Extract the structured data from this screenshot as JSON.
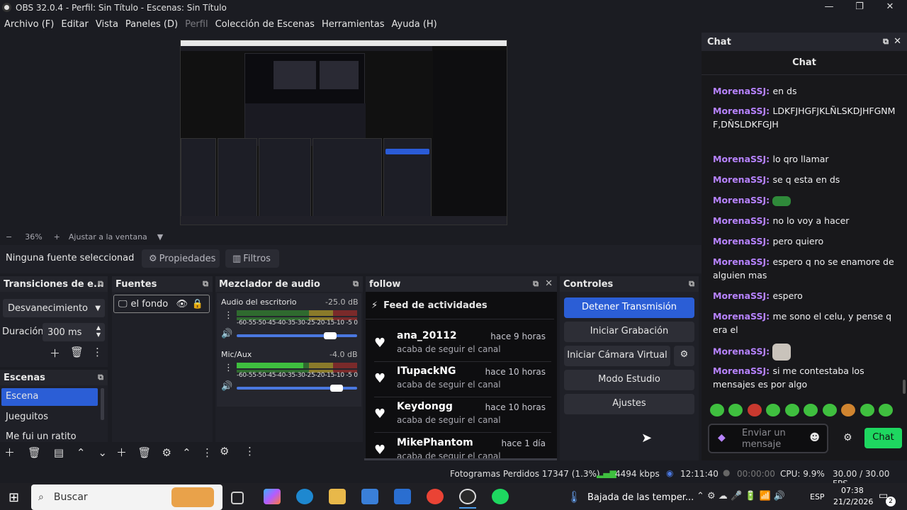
{
  "window": {
    "title": "OBS 32.0.4 - Perfil: Sin Título - Escenas: Sin Título"
  },
  "menu": [
    "Archivo (F)",
    "Editar",
    "Vista",
    "Paneles (D)",
    "Perfil",
    "Colección de Escenas",
    "Herramientas",
    "Ayuda (H)"
  ],
  "zoom": {
    "minus": "−",
    "level": "36%",
    "plus": "+",
    "fit": "Ajustar a la ventana"
  },
  "source_toolbar": {
    "no_source": "Ninguna fuente seleccionad",
    "properties": "Propiedades",
    "filters": "Filtros"
  },
  "transitions": {
    "title": "Transiciones de e...",
    "selected": "Desvanecimiento",
    "duration_label": "Duración",
    "duration_value": "300 ms"
  },
  "scenes": {
    "title": "Escenas",
    "items": [
      "Escena",
      "Jueguitos",
      "Me fui un ratito"
    ]
  },
  "sources": {
    "title": "Fuentes",
    "items": [
      "el fondo"
    ]
  },
  "mixer": {
    "title": "Mezclador de audio",
    "channels": [
      {
        "name": "Audio del escritorio",
        "db": "-25.0 dB",
        "level": 0.0,
        "volume": 0.83
      },
      {
        "name": "Mic/Aux",
        "db": "-4.0 dB",
        "level": 0.55,
        "volume": 0.88
      }
    ],
    "scale": "-60-55-50-45-40-35-30-25-20-15-10 -5  0"
  },
  "follow": {
    "title": "follow",
    "feed_title": "Feed de actividades",
    "items": [
      {
        "user": "ana_20112",
        "action": "acaba de seguir el canal",
        "time": "hace 9 horas"
      },
      {
        "user": "ITupackNG",
        "action": "acaba de seguir el canal",
        "time": "hace 10 horas"
      },
      {
        "user": "Keydongg",
        "action": "acaba de seguir el canal",
        "time": "hace 10 horas"
      },
      {
        "user": "MikePhantom",
        "action": "acaba de seguir el canal",
        "time": "hace 1 día"
      }
    ]
  },
  "controls": {
    "title": "Controles",
    "stop_stream": "Detener Transmisión",
    "start_recording": "Iniciar Grabación",
    "start_virtual_cam": "Iniciar Cámara Virtual",
    "studio_mode": "Modo Estudio",
    "settings": "Ajustes"
  },
  "chat": {
    "dock_title": "Chat",
    "header": "Chat",
    "messages": [
      {
        "user": "MorenaSSJ",
        "text": "en ds"
      },
      {
        "user": "MorenaSSJ",
        "text": "LDKFJHGFJKLÑLSKDJHFGNMF,DÑSLDKFGJH"
      },
      {
        "user": "MorenaSSJ",
        "text": "lo qro llamar"
      },
      {
        "user": "MorenaSSJ",
        "text": "se q esta en ds"
      },
      {
        "user": "MorenaSSJ",
        "text": ""
      },
      {
        "user": "MorenaSSJ",
        "text": "no lo voy a hacer"
      },
      {
        "user": "MorenaSSJ",
        "text": "pero quiero"
      },
      {
        "user": "MorenaSSJ",
        "text": "espero q no se enamore de alguien mas"
      },
      {
        "user": "MorenaSSJ",
        "text": "espero"
      },
      {
        "user": "MorenaSSJ",
        "text": "me sono el celu, y pense q era el"
      },
      {
        "user": "MorenaSSJ",
        "text": ""
      },
      {
        "user": "MorenaSSJ",
        "text": "si me contestaba los mensajes es por algo"
      }
    ],
    "input_placeholder": "Enviar un mensaje",
    "send_button": "Chat"
  },
  "status": {
    "dropped_frames": "Fotogramas Perdidos 17347 (1.3%)",
    "bitrate": "4494 kbps",
    "stream_time": "12:11:40",
    "rec_time": "00:00:00",
    "cpu": "CPU: 9.9%",
    "fps": "30.00 / 30.00 FPS"
  },
  "taskbar": {
    "search": "Buscar",
    "weather": "Bajada de las temper...",
    "language": "ESP",
    "time": "07:38",
    "date": "21/2/2026",
    "notifications": "2"
  }
}
